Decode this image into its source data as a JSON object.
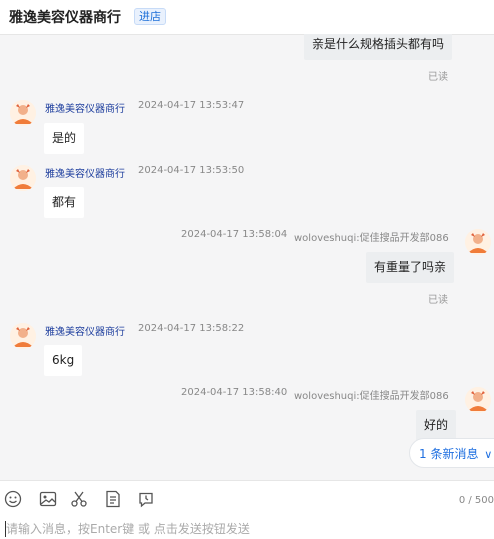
{
  "header": {
    "shop_name": "雅逸美容仪器商行",
    "enter_shop": "进店"
  },
  "chat": {
    "messages": [
      {
        "text": "亲是什么规格插头都有吗",
        "status": "已读"
      },
      {
        "sender": "雅逸美容仪器商行",
        "time": "2024-04-17 13:53:47",
        "text": "是的"
      },
      {
        "sender": "雅逸美容仪器商行",
        "time": "2024-04-17 13:53:50",
        "text": "都有"
      },
      {
        "time": "2024-04-17 13:58:04",
        "sender": "woloveshuqi:促佳搜品开发部086",
        "text": "有重量了吗亲",
        "status": "已读"
      },
      {
        "sender": "雅逸美容仪器商行",
        "time": "2024-04-17 13:58:22",
        "text": "6kg"
      },
      {
        "time": "2024-04-17 13:58:40",
        "sender": "woloveshuqi:促佳搜品开发部086",
        "text": "好的"
      }
    ],
    "new_messages": "1 条新消息"
  },
  "toolbar": {
    "icons": [
      "emoji-icon",
      "image-icon",
      "scissors-icon",
      "order-icon",
      "history-icon"
    ],
    "counter": "0 / 500",
    "input_placeholder": "请输入消息，按Enter键 或 点击发送按钮发送"
  }
}
